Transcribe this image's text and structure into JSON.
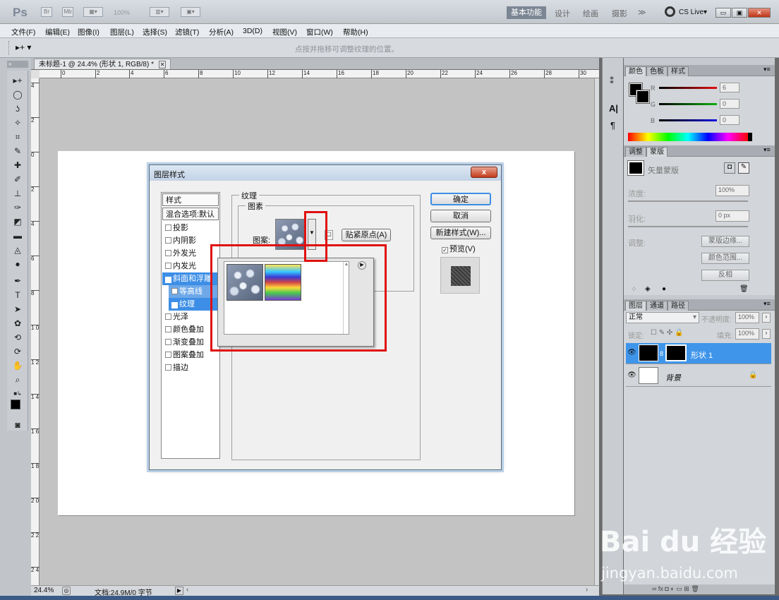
{
  "app": {
    "logo": "Ps",
    "mini_labels": [
      "Br",
      "Mb"
    ],
    "zoom_readout": "100%",
    "workspaces": [
      "基本功能",
      "设计",
      "绘画",
      "摄影",
      "≫"
    ],
    "cs_live": "CS Live▾"
  },
  "menu": [
    "文件(F)",
    "编辑(E)",
    "图像(I)",
    "图层(L)",
    "选择(S)",
    "滤镜(T)",
    "分析(A)",
    "3D(D)",
    "视图(V)",
    "窗口(W)",
    "帮助(H)"
  ],
  "options_bar": {
    "hint": "点按并拖移可调整纹理的位置。"
  },
  "document": {
    "tab_title": "未标题-1 @ 24.4% (形状 1, RGB/8) *",
    "ruler_top": [
      "0",
      "2",
      "4",
      "6",
      "8",
      "10",
      "12",
      "14",
      "16",
      "18",
      "20",
      "22",
      "24",
      "26",
      "28",
      "30"
    ],
    "ruler_left": [
      "4",
      "2",
      "0",
      "2",
      "4",
      "6",
      "8",
      "1 0",
      "1 2",
      "1 4",
      "1 6",
      "1 8",
      "2 0",
      "2 2",
      "2 4"
    ],
    "status_zoom": "24.4%",
    "status_doc": "文档:24.9M/0 字节"
  },
  "dialog": {
    "title": "图层样式",
    "close": "x",
    "style_list": [
      {
        "label": "样式",
        "type": "header"
      },
      {
        "label": "混合选项:默认",
        "type": "header"
      },
      {
        "label": "投影",
        "checked": false
      },
      {
        "label": "内阴影",
        "checked": false
      },
      {
        "label": "外发光",
        "checked": false
      },
      {
        "label": "内发光",
        "checked": false
      },
      {
        "label": "斜面和浮雕",
        "checked": true,
        "selected": true
      },
      {
        "label": "等高线",
        "checked": false,
        "sub": true
      },
      {
        "label": "纹理",
        "checked": true,
        "sub": true,
        "active": true
      },
      {
        "label": "光泽",
        "checked": false
      },
      {
        "label": "颜色叠加",
        "checked": false
      },
      {
        "label": "渐变叠加",
        "checked": false
      },
      {
        "label": "图案叠加",
        "checked": false
      },
      {
        "label": "描边",
        "checked": false
      }
    ],
    "section_title": "纹理",
    "group_title": "图素",
    "pattern_label": "图案:",
    "snap_button": "贴紧原点(A)",
    "buttons": {
      "ok": "确定",
      "cancel": "取消",
      "new_style": "新建样式(W)...",
      "preview": "预览(V)"
    },
    "preview_checked": true
  },
  "right_panel": {
    "color_tabs": [
      "颜色",
      "色板",
      "样式"
    ],
    "rgb": [
      {
        "channel": "R",
        "value": "6",
        "color": "#e01010"
      },
      {
        "channel": "G",
        "value": "0",
        "color": "#10b010"
      },
      {
        "channel": "B",
        "value": "0",
        "color": "#1010e0"
      }
    ],
    "mask_tabs": [
      "调整",
      "蒙版"
    ],
    "mask": {
      "title": "矢量蒙版",
      "density_label": "浓度:",
      "density_value": "100%",
      "feather_label": "羽化:",
      "feather_value": "0 px",
      "refine_label": "调整:",
      "edge_button": "蒙版边缘...",
      "color_range_button": "颜色范围...",
      "invert_button": "反相"
    },
    "layer_tabs": [
      "图层",
      "通道",
      "路径"
    ],
    "blend_mode": "正常",
    "opacity_label": "不透明度:",
    "opacity_value": "100%",
    "lock_label": "锁定:",
    "fill_label": "填充:",
    "fill_value": "100%",
    "layers": [
      {
        "name": "形状 1",
        "selected": true
      },
      {
        "name": "背景",
        "selected": false,
        "locked": true
      }
    ]
  },
  "watermark": {
    "brand": "Bai du 经验",
    "url": "jingyan.baidu.com"
  }
}
